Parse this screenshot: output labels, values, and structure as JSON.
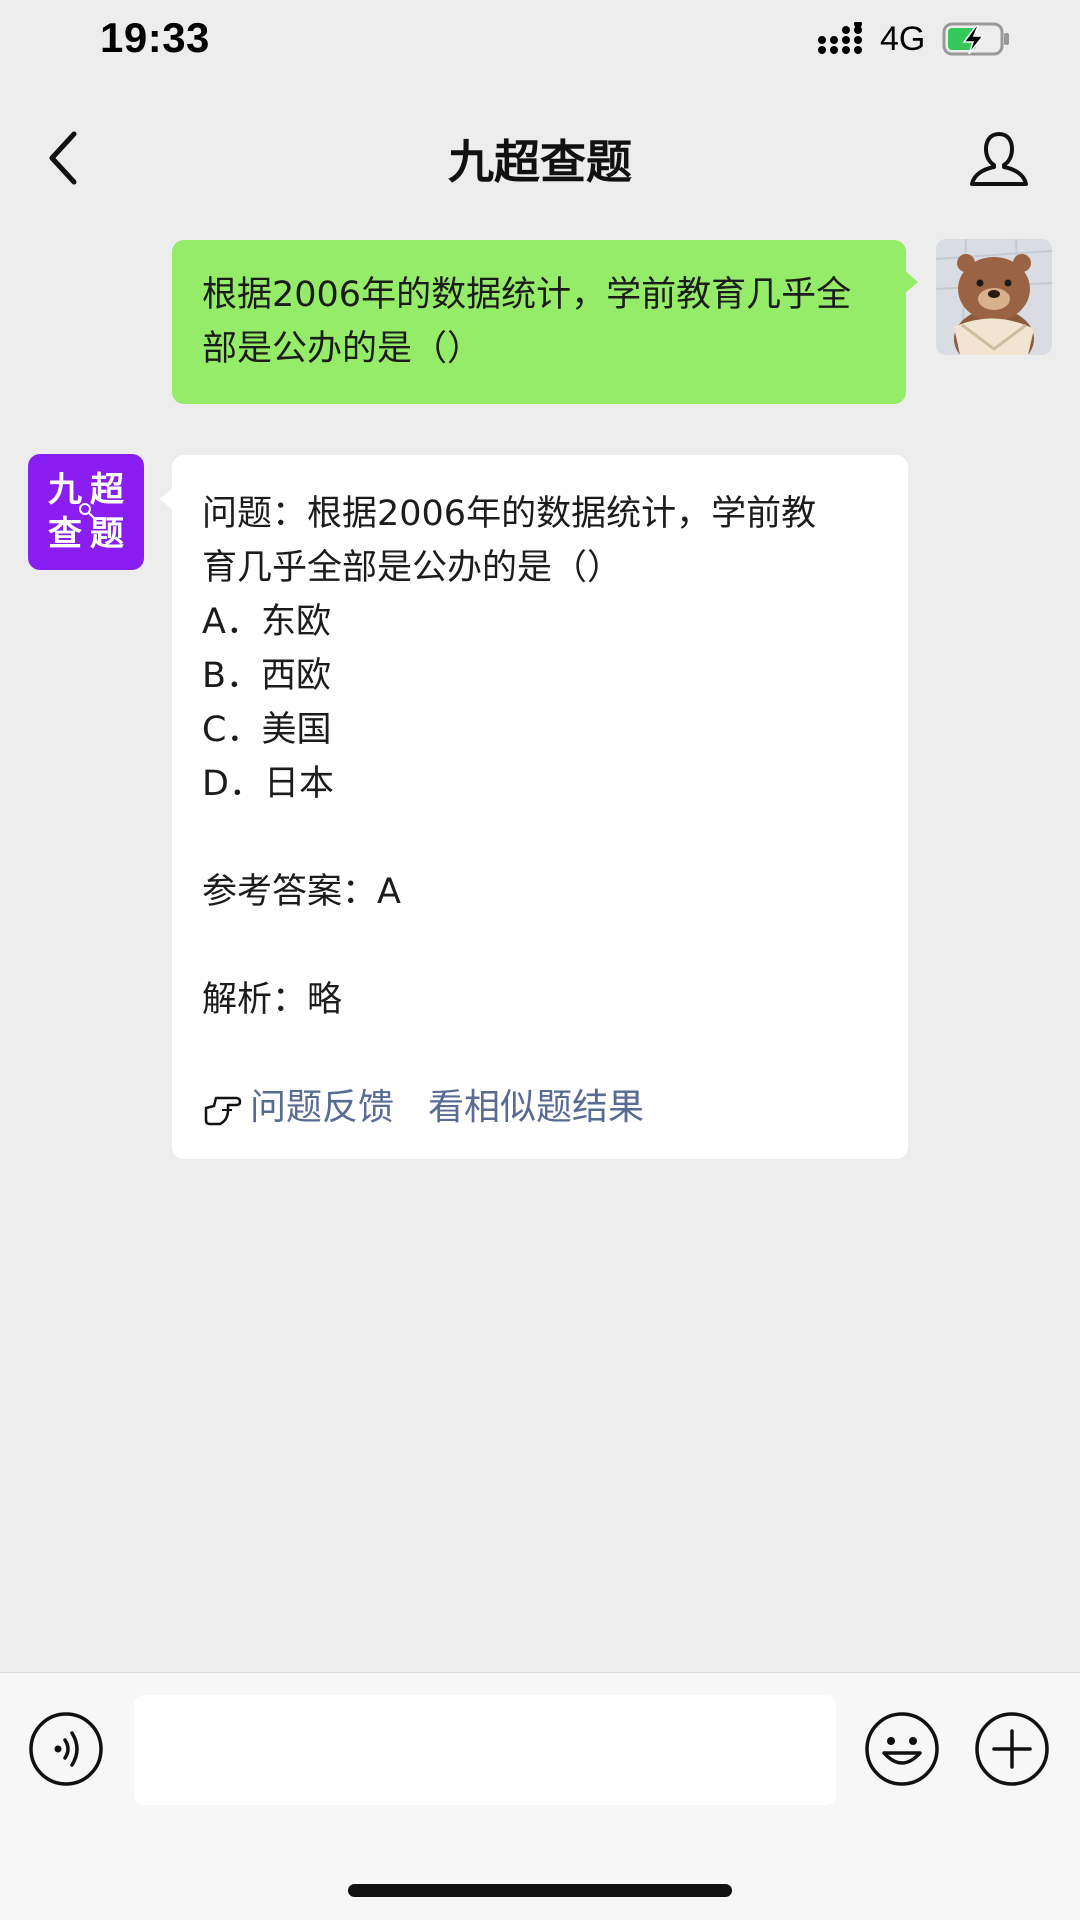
{
  "status_bar": {
    "time": "19:33",
    "network": "4G",
    "battery_charging": true
  },
  "nav": {
    "title": "九超查题",
    "back_icon": "chevron-left-icon",
    "profile_icon": "person-icon"
  },
  "user_message": {
    "text": "根据2006年的数据统计，学前教育几乎全部是公办的是（）",
    "bubble_color": "#95ec69"
  },
  "bot_avatar": {
    "chars": [
      "九",
      "超",
      "查",
      "题"
    ],
    "color": "#8a1ef0"
  },
  "bot_message": {
    "question_line1": "问题：根据2006年的数据统计，学前教",
    "question_line2": "育几乎全部是公办的是（）",
    "options": [
      "A．东欧",
      "B．西欧",
      "C．美国",
      "D．日本"
    ],
    "answer": "参考答案：A",
    "analysis": "解析：略",
    "feedback_link": "问题反馈",
    "similar_link": "看相似题结果",
    "link_color": "#576b95"
  },
  "input_bar": {
    "placeholder": "",
    "voice_icon": "voice-icon",
    "emoji_icon": "emoji-icon",
    "plus_icon": "plus-icon"
  }
}
